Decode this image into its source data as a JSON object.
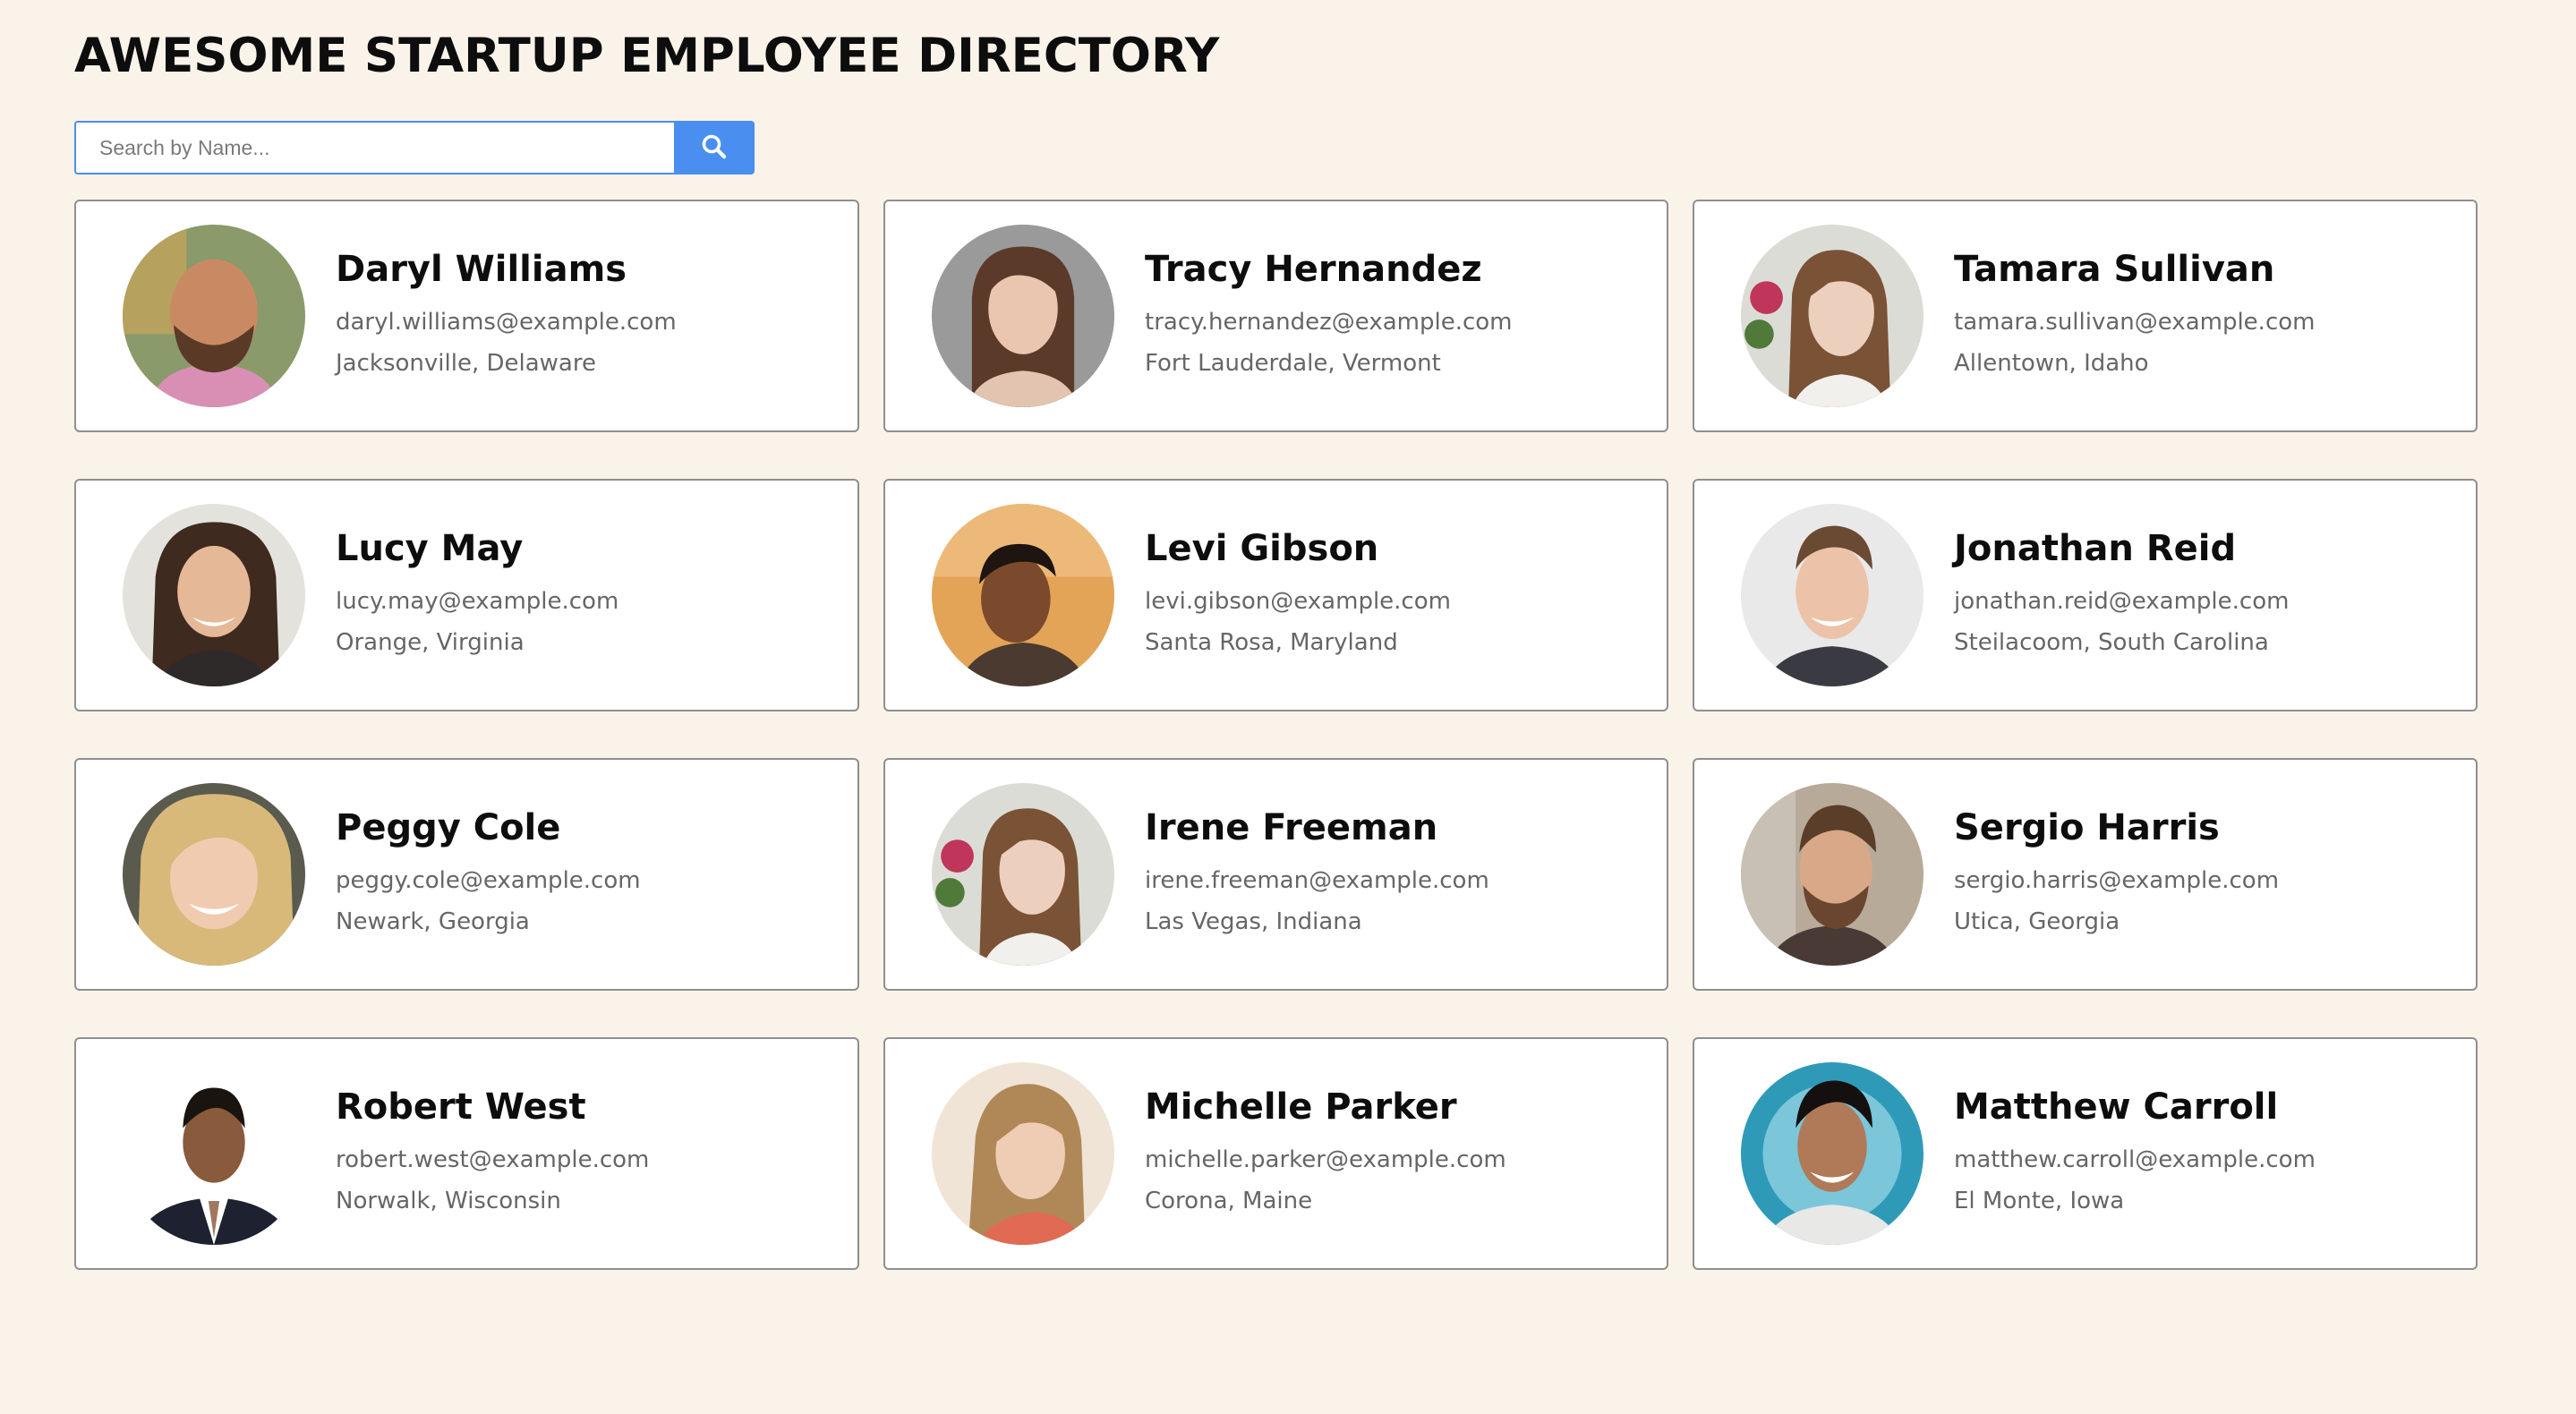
{
  "header": {
    "title": "AWESOME STARTUP EMPLOYEE DIRECTORY"
  },
  "search": {
    "placeholder": "Search by Name...",
    "icon": "search-icon",
    "accent_color": "#4a8ef0"
  },
  "employees": [
    {
      "name": "Daryl Williams",
      "email": "daryl.williams@example.com",
      "location": "Jacksonville, Delaware"
    },
    {
      "name": "Tracy Hernandez",
      "email": "tracy.hernandez@example.com",
      "location": "Fort Lauderdale, Vermont"
    },
    {
      "name": "Tamara Sullivan",
      "email": "tamara.sullivan@example.com",
      "location": "Allentown, Idaho"
    },
    {
      "name": "Lucy May",
      "email": "lucy.may@example.com",
      "location": "Orange, Virginia"
    },
    {
      "name": "Levi Gibson",
      "email": "levi.gibson@example.com",
      "location": "Santa Rosa, Maryland"
    },
    {
      "name": "Jonathan Reid",
      "email": "jonathan.reid@example.com",
      "location": "Steilacoom, South Carolina"
    },
    {
      "name": "Peggy Cole",
      "email": "peggy.cole@example.com",
      "location": "Newark, Georgia"
    },
    {
      "name": "Irene Freeman",
      "email": "irene.freeman@example.com",
      "location": "Las Vegas, Indiana"
    },
    {
      "name": "Sergio Harris",
      "email": "sergio.harris@example.com",
      "location": "Utica, Georgia"
    },
    {
      "name": "Robert West",
      "email": "robert.west@example.com",
      "location": "Norwalk, Wisconsin"
    },
    {
      "name": "Michelle Parker",
      "email": "michelle.parker@example.com",
      "location": "Corona, Maine"
    },
    {
      "name": "Matthew Carroll",
      "email": "matthew.carroll@example.com",
      "location": "El Monte, Iowa"
    }
  ]
}
